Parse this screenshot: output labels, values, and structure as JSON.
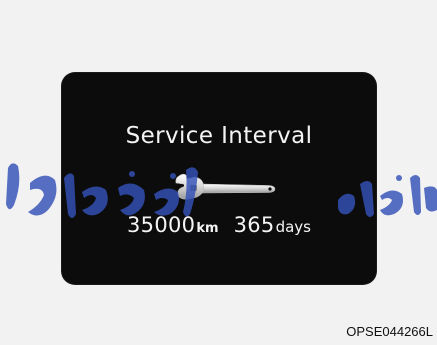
{
  "panel": {
    "title": "Service Interval",
    "distance_value": "35000",
    "distance_unit": "km",
    "days_value": "365",
    "days_unit": "days"
  },
  "watermark": {
    "text": "مداد خودرو فارما"
  },
  "figure_code": "OPSE044266L",
  "icons": {
    "wrench": "wrench-icon"
  },
  "colors": {
    "panel_background": "#0c0c0c",
    "panel_text": "#f4f4f4",
    "watermark": "#3552b8"
  }
}
